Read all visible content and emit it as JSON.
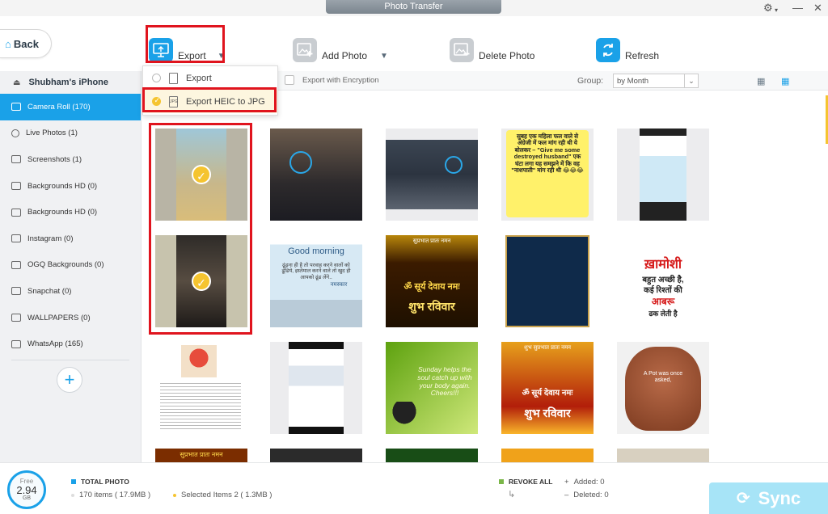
{
  "window": {
    "title": "Photo Transfer"
  },
  "toolbar": {
    "back_label": "Back",
    "export_label": "Export",
    "add_photo_label": "Add Photo",
    "delete_photo_label": "Delete Photo",
    "refresh_label": "Refresh"
  },
  "export_menu": {
    "items": [
      {
        "label": "Export",
        "selected": false
      },
      {
        "label": "Export HEIC to JPG",
        "selected": true
      }
    ]
  },
  "subbar": {
    "encryption_label": "Export with Encryption",
    "group_label": "Group:",
    "group_value": "by Month"
  },
  "sidebar": {
    "device_name": "Shubham's iPhone",
    "albums": [
      {
        "label": "Camera Roll (170)",
        "active": true,
        "icon": "camera-icon"
      },
      {
        "label": "Live Photos (1)",
        "active": false,
        "icon": "live-photo-icon"
      },
      {
        "label": "Screenshots (1)",
        "active": false,
        "icon": "screenshot-icon"
      },
      {
        "label": "Backgrounds HD (0)",
        "active": false,
        "icon": "album-icon"
      },
      {
        "label": "Backgrounds HD (0)",
        "active": false,
        "icon": "album-icon"
      },
      {
        "label": "Instagram (0)",
        "active": false,
        "icon": "album-icon"
      },
      {
        "label": "OGQ Backgrounds (0)",
        "active": false,
        "icon": "album-icon"
      },
      {
        "label": "Snapchat (0)",
        "active": false,
        "icon": "album-icon"
      },
      {
        "label": "WALLPAPERS (0)",
        "active": false,
        "icon": "album-icon"
      },
      {
        "label": "WhatsApp (165)",
        "active": false,
        "icon": "album-icon"
      }
    ]
  },
  "photos": {
    "t3_text": "सुबह एक महिला फल वाले से अंग्रेजी में फल मांग रही थी ये बोलकर – \"Give me some destroyed husband\" एक घंटा लगा यह समझने में कि वह \"नाशपाती\" मांग रही थी 😂😂😂",
    "t5_title": "Good morning",
    "t5_sub": "ढूंढना ही है तो परवाह करने वालों को ढूंढिये, इस्तेमाल करने वाले तो खुद ही आपको ढूंढ लेंगे..",
    "t5_greet": "नमस्कार",
    "t6_top": "सुप्रभात  प्रातः नमन",
    "t6_mid": "ॐ सूर्य देवाय नमः",
    "t6_bot": "शुभ रविवार",
    "t8_title": "ख़ामोशी",
    "t8_line1": "बहुत अच्छी है,",
    "t8_line2": "कई रिश्तों की",
    "t8_line3": "आबरू",
    "t8_line4": "ढक लेती है",
    "t11_text": "Sunday helps the soul catch up with your body again. Cheers!!!",
    "t12_top": "शुभ सुप्रभात  प्रातः नमन",
    "t12_mid": "ॐ सूर्य देवाय नमः",
    "t12_bot": "शुभ रविवार",
    "t13_text": "A Pot was once asked,",
    "t14_top": "सुप्रभात  प्रातः नमन"
  },
  "bottom": {
    "storage_free_label": "Free",
    "storage_value": "2.94",
    "storage_unit": "GB",
    "total_label": "TOTAL PHOTO",
    "total_items": "170 items ( 17.9MB )",
    "selected_items": "Selected Items 2 ( 1.3MB )",
    "revoke_label": "REVOKE ALL",
    "added_label": "Added: 0",
    "deleted_label": "Deleted: 0",
    "sync_label": "Sync"
  },
  "colors": {
    "accent": "#1aa1e8",
    "selection": "#f5c430",
    "highlight": "#e0141e",
    "sync": "#a7e4f7"
  }
}
